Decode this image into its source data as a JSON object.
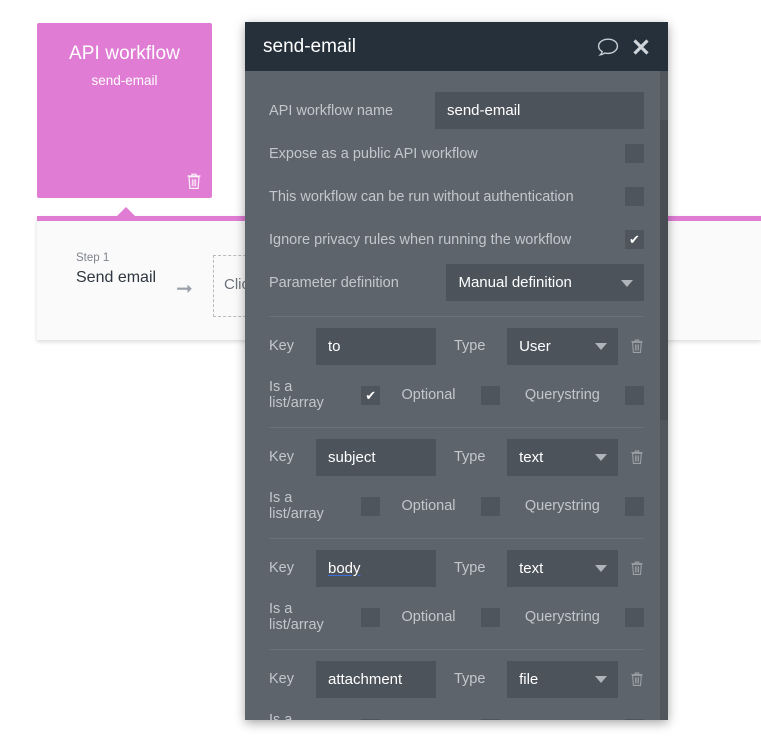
{
  "canvas": {
    "card": {
      "title": "API workflow",
      "subtitle": "send-email",
      "delete_icon": "trash-icon",
      "color": "#e07cd4"
    },
    "step_panel": {
      "step_label": "Step 1",
      "step_name": "Send email",
      "arrow_icon": "arrow-right-icon",
      "dropzone_text": "Click",
      "accent_color": "#e07cd4"
    }
  },
  "modal": {
    "title": "send-email",
    "comment_icon": "comment-icon",
    "close_icon": "close-icon",
    "header_bg": "#25303a",
    "body_bg": "#5d646b",
    "fields": {
      "workflow_name_label": "API workflow name",
      "workflow_name_value": "send-email",
      "expose_public_label": "Expose as a public API workflow",
      "expose_public_checked": false,
      "no_auth_label": "This workflow can be run without authentication",
      "no_auth_checked": false,
      "ignore_privacy_label": "Ignore privacy rules when running the workflow",
      "ignore_privacy_checked": true,
      "parameter_definition_label": "Parameter definition",
      "parameter_definition_value": "Manual definition"
    },
    "param_labels": {
      "key": "Key",
      "type": "Type",
      "is_list": "Is a list/array",
      "optional": "Optional",
      "querystring": "Querystring",
      "delete_icon": "trash-icon",
      "caret_icon": "chevron-down-icon"
    },
    "parameters": [
      {
        "key": "to",
        "type": "User",
        "is_list": true,
        "optional": false,
        "querystring": false,
        "spellcheck": false
      },
      {
        "key": "subject",
        "type": "text",
        "is_list": false,
        "optional": false,
        "querystring": false,
        "spellcheck": false
      },
      {
        "key": "body",
        "type": "text",
        "is_list": false,
        "optional": false,
        "querystring": false,
        "spellcheck": true
      },
      {
        "key": "attachment",
        "type": "file",
        "is_list": false,
        "optional": false,
        "querystring": false,
        "spellcheck": false
      }
    ],
    "check_glyph": "✔"
  }
}
